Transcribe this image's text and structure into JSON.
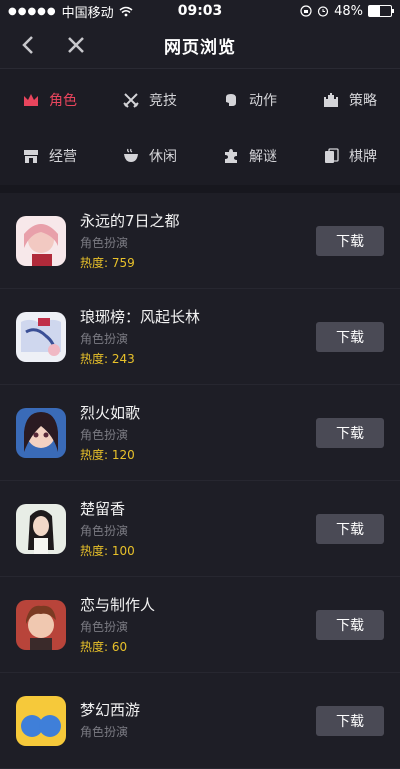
{
  "status": {
    "carrier": "中国移动",
    "time": "09:03",
    "battery": "48%",
    "battery_level": 0.48
  },
  "nav": {
    "title": "网页浏览"
  },
  "categories": [
    {
      "label": "角色",
      "icon": "crown-icon",
      "active": true
    },
    {
      "label": "竞技",
      "icon": "crossed-swords-icon",
      "active": false
    },
    {
      "label": "动作",
      "icon": "fist-icon",
      "active": false
    },
    {
      "label": "策略",
      "icon": "castle-icon",
      "active": false
    },
    {
      "label": "经营",
      "icon": "shop-icon",
      "active": false
    },
    {
      "label": "休闲",
      "icon": "teacup-icon",
      "active": false
    },
    {
      "label": "解谜",
      "icon": "puzzle-icon",
      "active": false
    },
    {
      "label": "棋牌",
      "icon": "cards-icon",
      "active": false
    }
  ],
  "apps": [
    {
      "name": "永远的7日之都",
      "genre": "角色扮演",
      "heat": "热度: 759",
      "button": "下载"
    },
    {
      "name": "琅琊榜：风起长林",
      "genre": "角色扮演",
      "heat": "热度: 243",
      "button": "下载"
    },
    {
      "name": "烈火如歌",
      "genre": "角色扮演",
      "heat": "热度: 120",
      "button": "下载"
    },
    {
      "name": "楚留香",
      "genre": "角色扮演",
      "heat": "热度: 100",
      "button": "下载"
    },
    {
      "name": "恋与制作人",
      "genre": "角色扮演",
      "heat": "热度: 60",
      "button": "下载"
    },
    {
      "name": "梦幻西游",
      "genre": "角色扮演",
      "heat": "",
      "button": "下载"
    }
  ],
  "colors": {
    "accent": "#e8455d",
    "heat": "#e8c12a",
    "background": "#1e1e26",
    "button": "#4a4a55"
  }
}
